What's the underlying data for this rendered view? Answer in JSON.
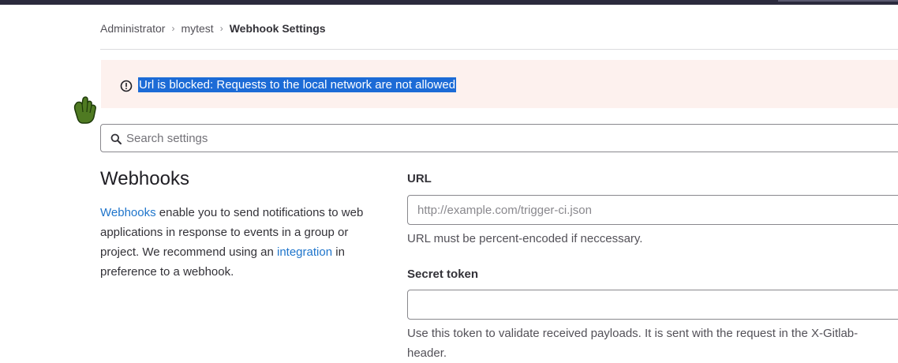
{
  "breadcrumb": {
    "items": [
      "Administrator",
      "mytest"
    ],
    "separator": "›",
    "current": "Webhook Settings"
  },
  "alert": {
    "message": "Url is blocked: Requests to the local network are not allowed",
    "icon": "exclamation-circle-icon",
    "background": "#fdf1ee",
    "selection_color": "#1c6bd6"
  },
  "search": {
    "placeholder": "Search settings",
    "icon": "search-icon"
  },
  "left": {
    "title": "Webhooks",
    "desc_link1": "Webhooks",
    "desc_part1": " enable you to send notifications to web applications in response to events in a group or project. We recommend using an ",
    "desc_link2": "integration",
    "desc_part2": " in preference to a webhook.",
    "link_color": "#1f75cb"
  },
  "form": {
    "url_label": "URL",
    "url_placeholder": "http://example.com/trigger-ci.json",
    "url_help": "URL must be percent-encoded if neccessary.",
    "token_label": "Secret token",
    "token_value": "",
    "token_help_line1": "Use this token to validate received payloads. It is sent with the request in the X-Gitlab-",
    "token_help_line2": "header."
  }
}
